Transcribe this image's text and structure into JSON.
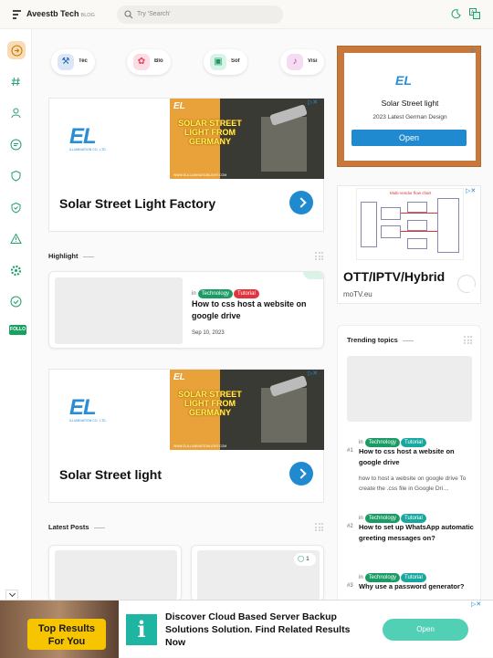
{
  "header": {
    "brand": "Aveestb Tech",
    "brand_tag": "BLOG",
    "search_placeholder": "Try 'Search'"
  },
  "sidebar": {
    "follow_label": "FOLLO"
  },
  "categories": [
    {
      "label": "Tec",
      "icon": "tools-icon",
      "color": "#dbe6f7"
    },
    {
      "label": "Blo",
      "icon": "flower-icon",
      "color": "#fbdde3"
    },
    {
      "label": "Sof",
      "icon": "gamepad-icon",
      "color": "#d9f3e6"
    },
    {
      "label": "Visi",
      "icon": "music-icon",
      "color": "#f5dcf0"
    }
  ],
  "ads": {
    "el_logo": "EL",
    "el_logo_sub": "ILLUMINATION CO., LTD.",
    "solar_text": "SOLAR STREET LIGHT FROM GERMANY",
    "solar_url": "WWW.ELILLUMINATIONLIGHT.COM",
    "ad1_title": "Solar Street Light Factory",
    "ad2_title": "Solar Street light",
    "side_ad": {
      "title": "Solar Street light",
      "subtitle": "2023 Latest German Design",
      "button": "Open"
    },
    "ott": {
      "chart_title": "Multi-vendor flow chart",
      "title": "OTT/IPTV/Hybrid",
      "domain": "moTV.eu"
    },
    "bottom": {
      "image_text": "Top Results For You",
      "text": "Discover Cloud Based Server Backup Solutions Solution. Find Related Results Now",
      "button": "Open"
    }
  },
  "highlight": {
    "section_title": "Highlight",
    "post": {
      "in": "in",
      "tags": [
        "Technology",
        "Tutorial"
      ],
      "title": "How to css host a website on google drive",
      "date": "Sep 10, 2023"
    }
  },
  "latest": {
    "section_title": "Latest Posts",
    "comment_count": "1"
  },
  "trending": {
    "section_title": "Trending topics",
    "items": [
      {
        "num": "#1",
        "in": "in",
        "tags": [
          "Technology",
          "Tutorial"
        ],
        "title": "How to css host a website on google drive",
        "excerpt": "how to host a website on google drive To create the .css file in Google Dri…"
      },
      {
        "num": "#2",
        "in": "in",
        "tags": [
          "Technology",
          "Tutorial"
        ],
        "title": "How to set up WhatsApp automatic greeting messages on?",
        "excerpt": ""
      },
      {
        "num": "#3",
        "in": "in",
        "tags": [
          "Technology",
          "Tutorial"
        ],
        "title": "Why use a password generator?",
        "excerpt": ""
      }
    ]
  }
}
